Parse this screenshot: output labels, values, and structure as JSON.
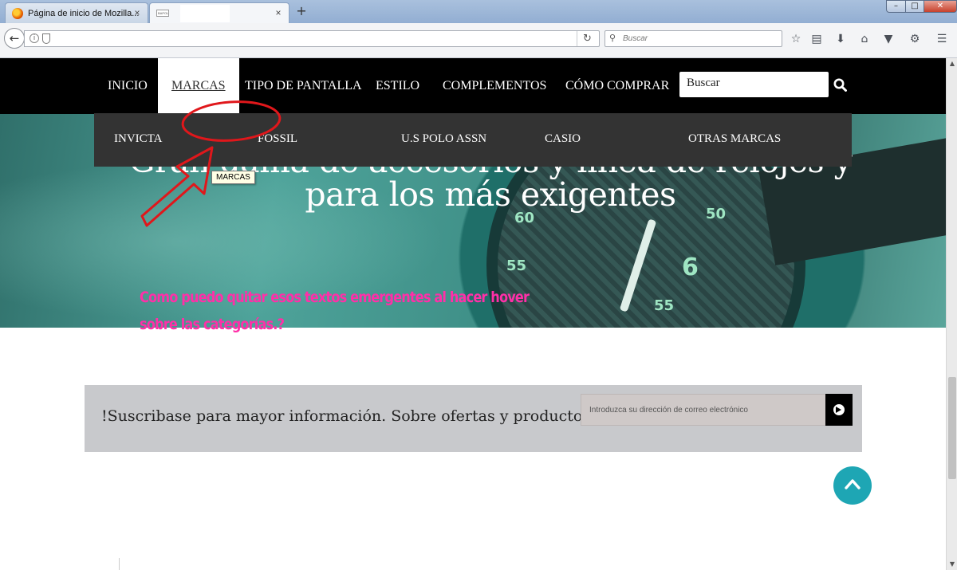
{
  "browser": {
    "tabs": [
      {
        "title": "Página de inicio de Mozilla...",
        "icon": "firefox-icon",
        "active": false
      },
      {
        "title": "",
        "icon": "page-thumbnail-icon",
        "active": true
      }
    ],
    "tab_close_glyph": "×",
    "new_tab_glyph": "+",
    "window_controls": {
      "minimize": "–",
      "maximize": "□",
      "close": "✕"
    },
    "url": "",
    "search_placeholder": "Buscar",
    "toolbar_icons": [
      "bookmark-star-icon",
      "reading-list-icon",
      "download-icon",
      "home-icon",
      "pocket-icon",
      "extension-icon",
      "menu-icon"
    ]
  },
  "site": {
    "nav": {
      "items": [
        "INICIO",
        "MARCAS",
        "TIPO DE PANTALLA",
        "ESTILO",
        "COMPLEMENTOS",
        "CÓMO COMPRAR"
      ],
      "active": "MARCAS",
      "search_value": "Buscar"
    },
    "dropdown": {
      "items": [
        "INVICTA",
        "FOSSIL",
        "U.S POLO ASSN",
        "CASIO",
        "OTRAS MARCAS"
      ]
    },
    "tooltip": "MARCAS",
    "hero": {
      "title_line1": "Gran gama de accesorios y línea de relojes y",
      "title_line2": "para los más exigentes",
      "dial_numbers": [
        "50",
        "55",
        "6",
        "60",
        "55"
      ]
    },
    "annotation": {
      "question_line1": "Como puedo quitar  esos textos emergentes al hacer hover",
      "question_line2": "sobre las categorías.?",
      "color": "#ff2fa8",
      "circle_color": "#e0171b"
    },
    "subscribe": {
      "text": "!Suscribase para mayor información. Sobre ofertas y productos.",
      "email_placeholder": "Introduzca su dirección de correo electrónico"
    },
    "colors": {
      "nav_bg": "#000000",
      "dropdown_bg": "#333333",
      "subscribe_bg": "#c8c9cc",
      "scroll_top_bg": "#1ea6b4"
    }
  }
}
